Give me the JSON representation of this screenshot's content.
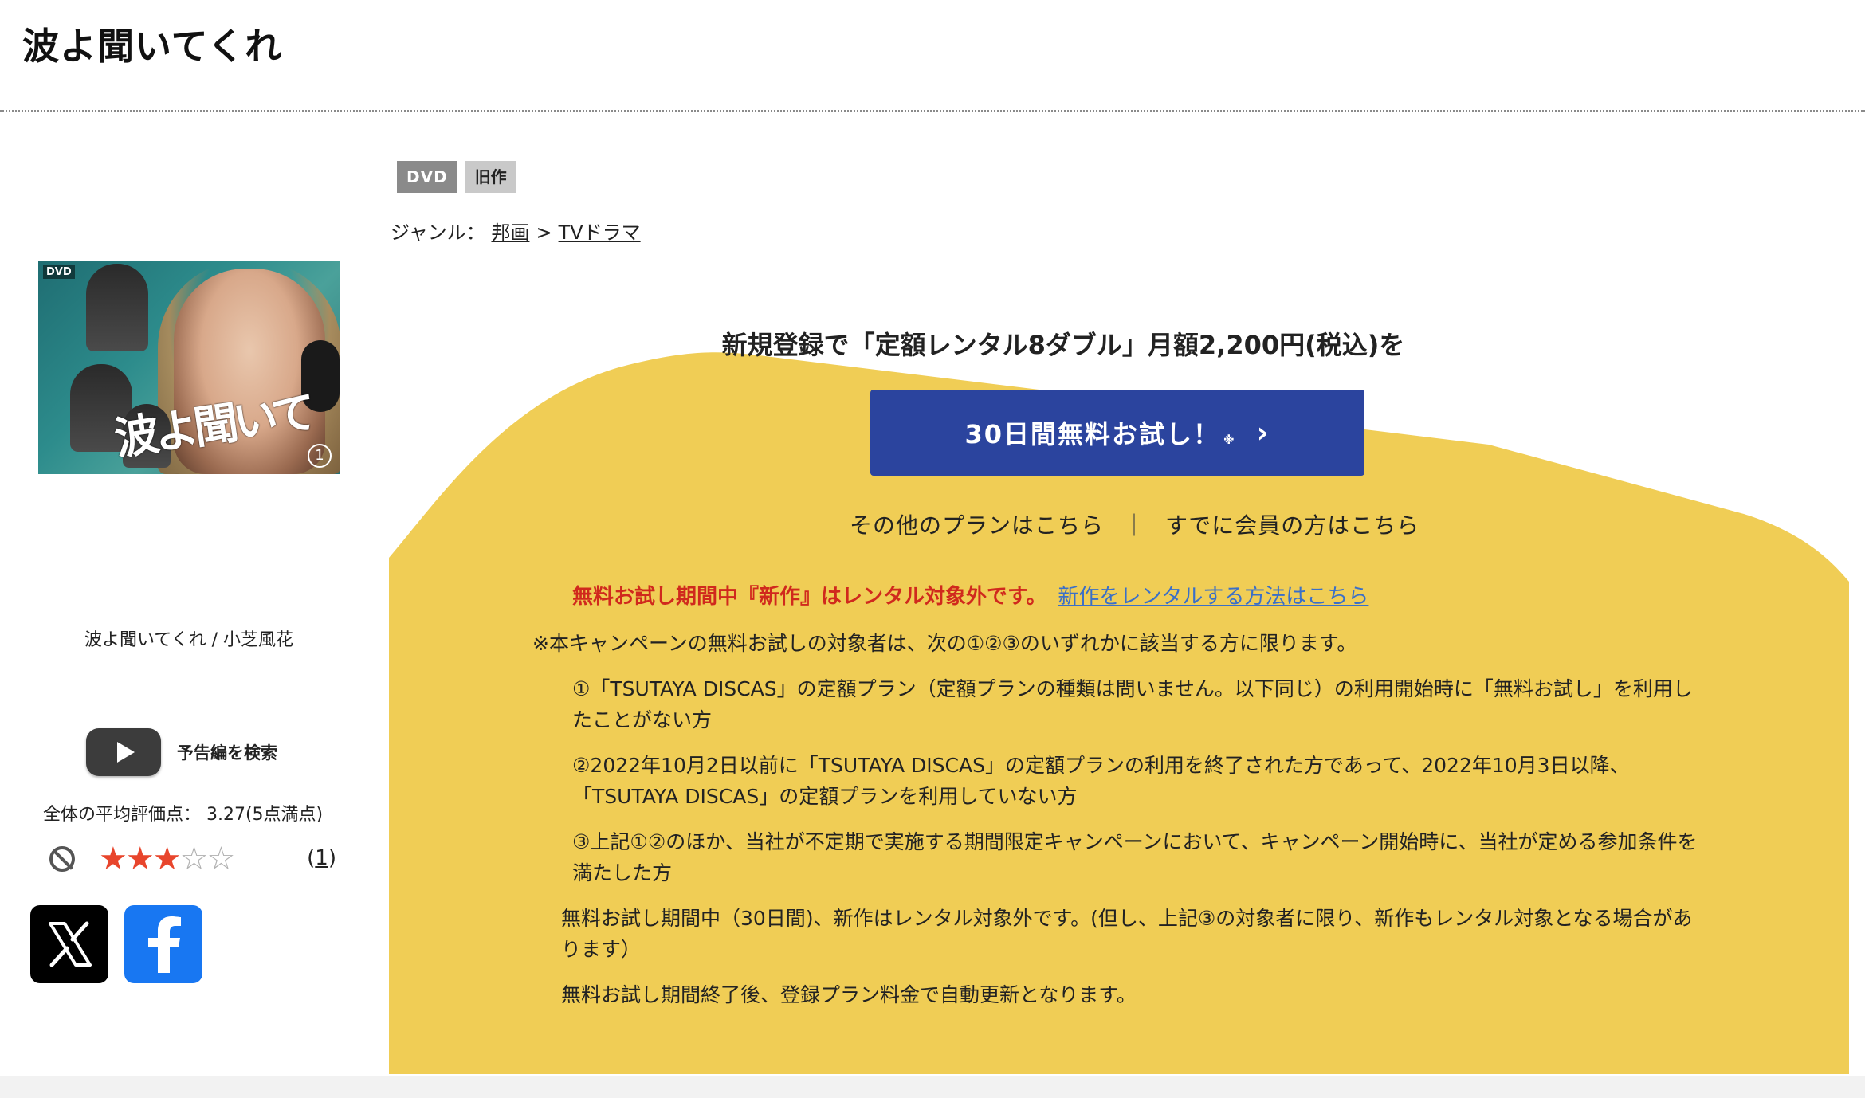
{
  "page": {
    "title": "波よ聞いてくれ"
  },
  "item": {
    "caption": "波よ聞いてくれ / 小芝風花",
    "cover": {
      "dvd_mark": "DVD",
      "title_art": "波よ聞いてくれ",
      "disc_number": "1"
    },
    "badges": [
      "DVD",
      "旧作"
    ],
    "genre": {
      "label": "ジャンル：",
      "path": [
        "邦画",
        "TVドラマ"
      ],
      "separator": ">"
    }
  },
  "trailer": {
    "label": "予告編を検索",
    "icon": "youtube-play-icon"
  },
  "rating": {
    "average_text": "全体の平均評価点： 3.27(5点満点)",
    "average": 3.27,
    "max": 5,
    "review_count": "1",
    "no_rating_icon": "prohibited-icon"
  },
  "share": {
    "x_icon": "x-logo-icon",
    "facebook_icon": "facebook-logo-icon"
  },
  "campaign": {
    "headline": "新規登録で「定額レンタル8ダブル」月額2,200円(税込)を",
    "button_label": "30日間無料お試し！",
    "button_note_mark": "※",
    "other_plans": "その他のプランはこちら",
    "separator": "｜",
    "member_link": "すでに会員の方はこちら",
    "warning_text": "無料お試し期間中『新作』はレンタル対象外です。",
    "warning_link": "新作をレンタルする方法はこちら",
    "terms_intro": "※本キャンペーンの無料お試しの対象者は、次の①②③のいずれかに該当する方に限ります。",
    "conditions": [
      "①「TSUTAYA DISCAS」の定額プラン（定額プランの種類は問いません。以下同じ）の利用開始時に「無料お試し」を利用したことがない方",
      "②2022年10月2日以前に「TSUTAYA DISCAS」の定額プランの利用を終了された方であって、2022年10月3日以降、「TSUTAYA DISCAS」の定額プランを利用していない方",
      "③上記①②のほか、当社が不定期で実施する期間限定キャンペーンにおいて、キャンペーン開始時に、当社が定める参加条件を満たした方"
    ],
    "notes": [
      "無料お試し期間中（30日間)、新作はレンタル対象外です。(但し、上記③の対象者に限り、新作もレンタル対象となる場合があります）",
      "無料お試し期間終了後、登録プラン料金で自動更新となります。"
    ],
    "colors": {
      "background": "#f0cd55",
      "button": "#2b449e",
      "warning": "#d0291d",
      "link": "#3a6fc8"
    }
  }
}
